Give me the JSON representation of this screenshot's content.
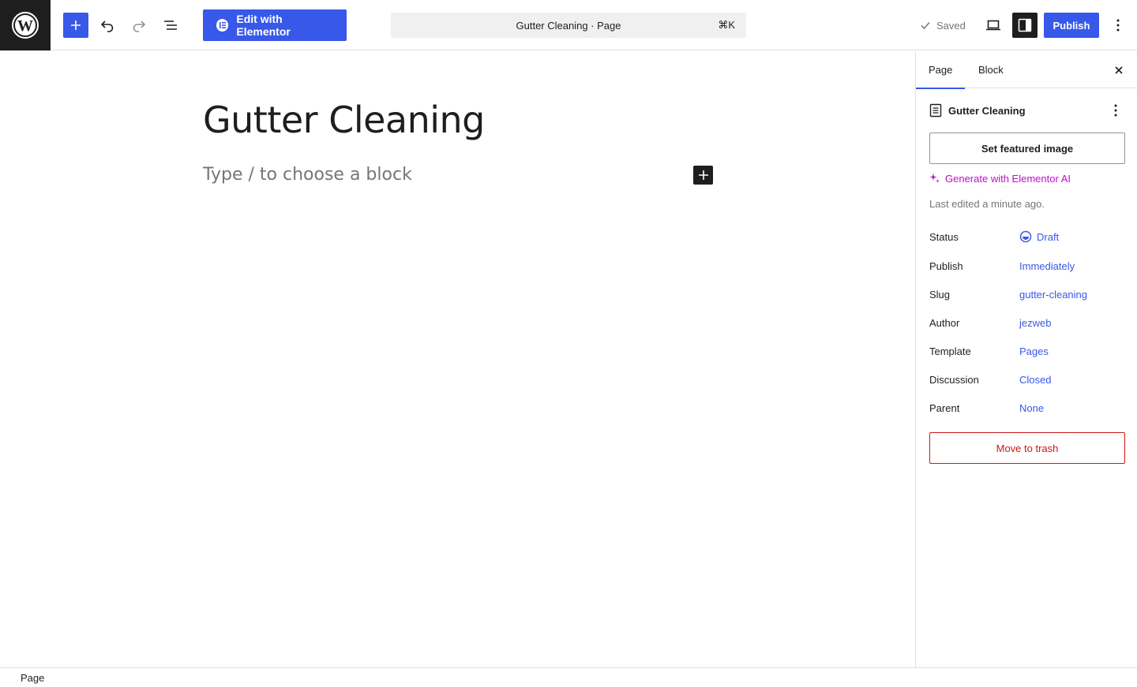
{
  "header": {
    "edit_with_elementor": "Edit with Elementor",
    "command_bar_title": "Gutter Cleaning · Page",
    "command_shortcut": "⌘K",
    "saved_label": "Saved",
    "publish_label": "Publish"
  },
  "editor": {
    "title": "Gutter Cleaning",
    "placeholder": "Type / to choose a block"
  },
  "sidebar": {
    "tabs": [
      "Page",
      "Block"
    ],
    "document_title": "Gutter Cleaning",
    "featured_image_button": "Set featured image",
    "ai_link": "Generate with Elementor AI",
    "last_edited": "Last edited a minute ago.",
    "meta": [
      {
        "label": "Status",
        "value": "Draft"
      },
      {
        "label": "Publish",
        "value": "Immediately"
      },
      {
        "label": "Slug",
        "value": "gutter-cleaning"
      },
      {
        "label": "Author",
        "value": "jezweb"
      },
      {
        "label": "Template",
        "value": "Pages"
      },
      {
        "label": "Discussion",
        "value": "Closed"
      },
      {
        "label": "Parent",
        "value": "None"
      }
    ],
    "trash_button": "Move to trash"
  },
  "footer": {
    "breadcrumb": "Page"
  },
  "colors": {
    "accent": "#3858e9",
    "ai": "#c00ec9",
    "danger": "#cc1818",
    "dark": "#1e1e1e"
  }
}
